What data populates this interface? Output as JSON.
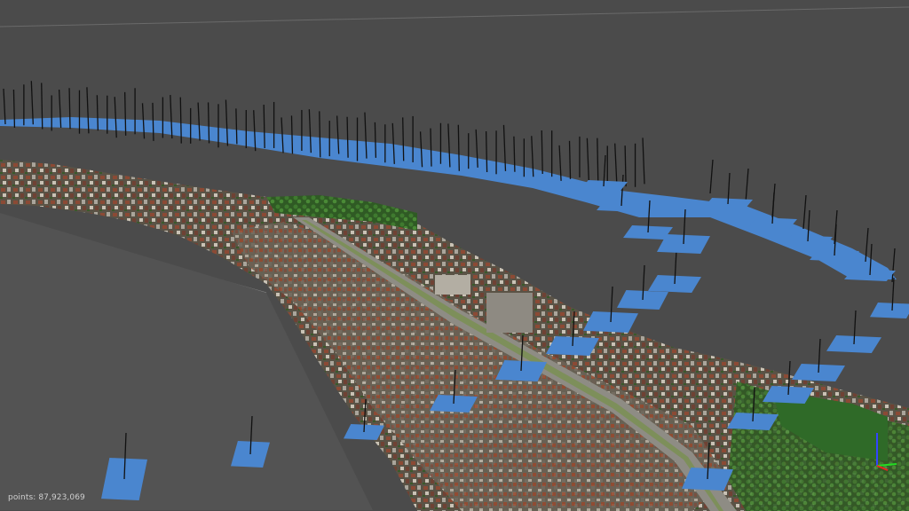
{
  "status": {
    "points_label": "points:",
    "points_value": "87,923,069"
  },
  "colors": {
    "background": "#4b4b4b",
    "camera_frame": "#4a86cf",
    "camera_stem": "#111111",
    "grid_line": "#8d8d8d",
    "axis_x": "#22dd22",
    "axis_y": "#3344ff",
    "axis_z": "#ee2222"
  },
  "icons": {
    "axis_gizmo": "xyz-axis-gizmo-icon"
  }
}
